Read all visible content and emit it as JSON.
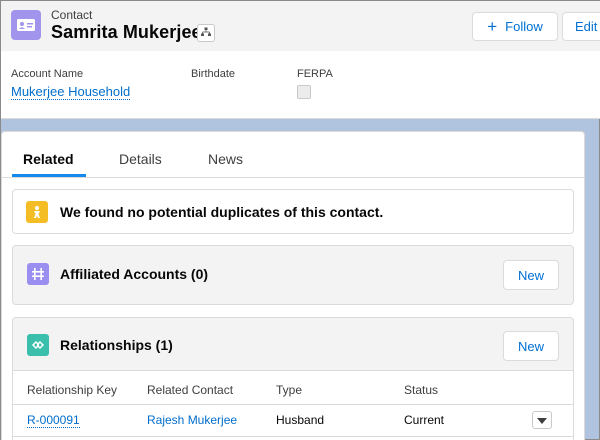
{
  "header": {
    "object_label": "Contact",
    "record_name": "Samrita Mukerjee",
    "object_icon": "contact-card-icon",
    "follow_label": "Follow",
    "edit_label": "Edit"
  },
  "highlights": {
    "account_name_label": "Account Name",
    "account_name_value": "Mukerjee Household",
    "birthdate_label": "Birthdate",
    "ferpa_label": "FERPA"
  },
  "tabs": [
    {
      "label": "Related",
      "active": true
    },
    {
      "label": "Details",
      "active": false
    },
    {
      "label": "News",
      "active": false
    }
  ],
  "duplicates": {
    "message": "We found no potential duplicates of this contact."
  },
  "affiliated_accounts": {
    "title": "Affiliated Accounts (0)",
    "new_label": "New"
  },
  "relationships": {
    "title": "Relationships (1)",
    "new_label": "New",
    "columns": [
      "Relationship Key",
      "Related Contact",
      "Type",
      "Status"
    ],
    "rows": [
      {
        "key": "R-000091",
        "related_contact": "Rajesh Mukerjee",
        "type": "Husband",
        "status": "Current"
      }
    ]
  },
  "colors": {
    "contact_icon": "#a094ed",
    "duplicates_icon": "#f4bc25",
    "affiliations_icon": "#9a8ef0",
    "relationships_icon": "#3bbfad",
    "link": "#006dcc",
    "active_tab": "#1589ee",
    "background": "#b0c4df"
  }
}
